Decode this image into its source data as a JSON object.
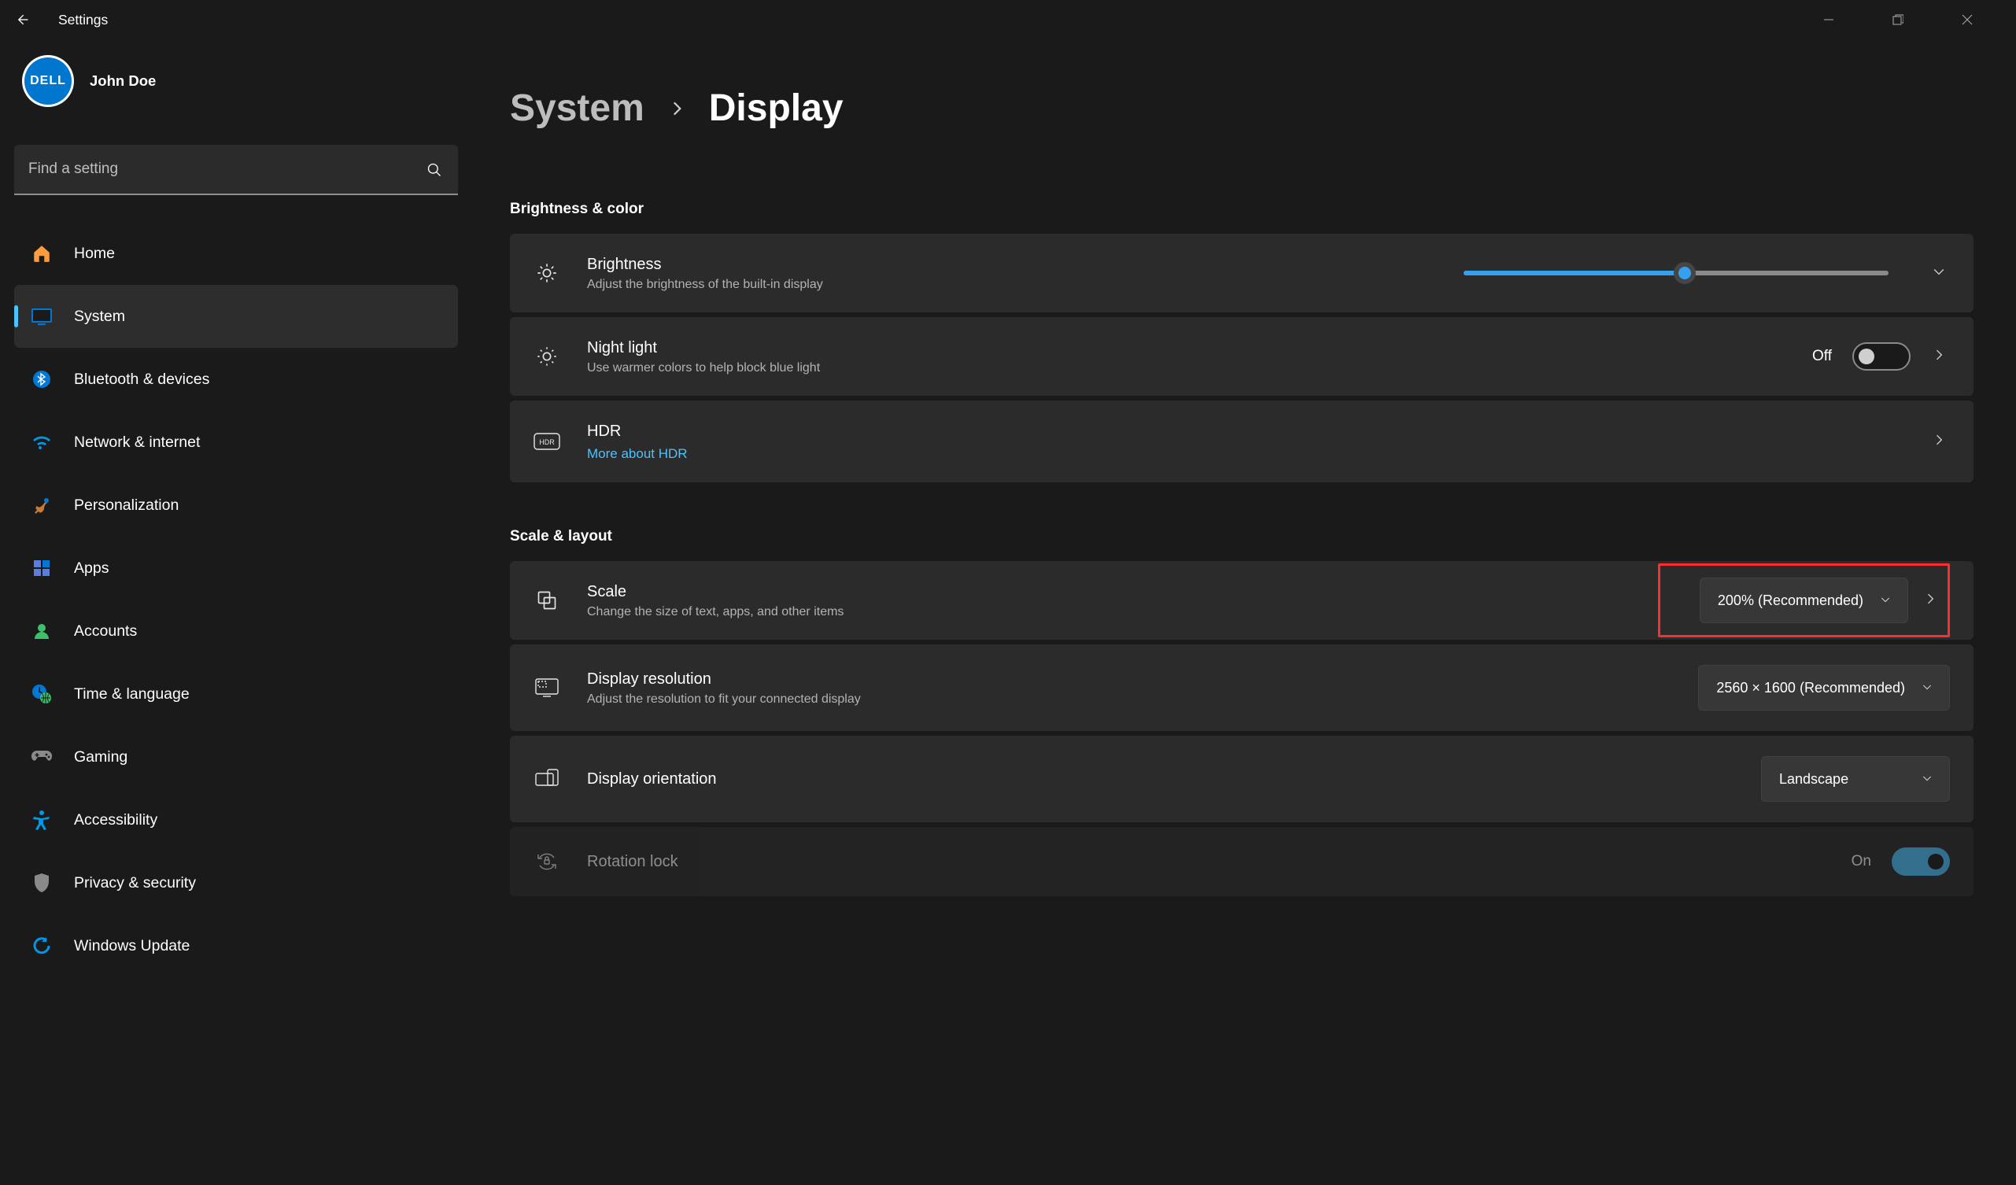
{
  "app": {
    "title": "Settings"
  },
  "user": {
    "name": "John Doe",
    "avatar_text": "DELL"
  },
  "search": {
    "placeholder": "Find a setting"
  },
  "sidebar": {
    "items": [
      {
        "label": "Home"
      },
      {
        "label": "System"
      },
      {
        "label": "Bluetooth & devices"
      },
      {
        "label": "Network & internet"
      },
      {
        "label": "Personalization"
      },
      {
        "label": "Apps"
      },
      {
        "label": "Accounts"
      },
      {
        "label": "Time & language"
      },
      {
        "label": "Gaming"
      },
      {
        "label": "Accessibility"
      },
      {
        "label": "Privacy & security"
      },
      {
        "label": "Windows Update"
      }
    ],
    "active": "System"
  },
  "breadcrumb": {
    "parent": "System",
    "current": "Display"
  },
  "sections": {
    "brightness_color": {
      "label": "Brightness & color",
      "brightness": {
        "title": "Brightness",
        "subtitle": "Adjust the brightness of the built-in display",
        "value_pct": 52
      },
      "night_light": {
        "title": "Night light",
        "subtitle": "Use warmer colors to help block blue light",
        "state_label": "Off",
        "on": false
      },
      "hdr": {
        "title": "HDR",
        "link": "More about HDR"
      }
    },
    "scale_layout": {
      "label": "Scale & layout",
      "scale": {
        "title": "Scale",
        "subtitle": "Change the size of text, apps, and other items",
        "value": "200% (Recommended)"
      },
      "resolution": {
        "title": "Display resolution",
        "subtitle": "Adjust the resolution to fit your connected display",
        "value": "2560 × 1600 (Recommended)"
      },
      "orientation": {
        "title": "Display orientation",
        "value": "Landscape"
      },
      "rotation_lock": {
        "title": "Rotation lock",
        "state_label": "On",
        "on": true
      }
    }
  }
}
